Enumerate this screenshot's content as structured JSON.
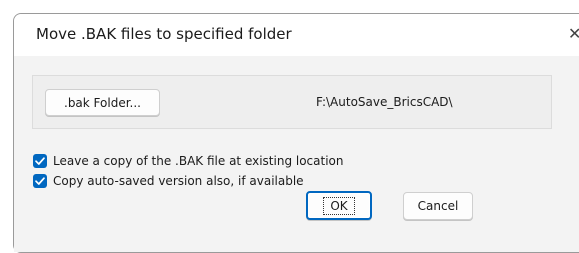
{
  "dialog": {
    "title": "Move .BAK files to specified folder",
    "close_symbol": "✕"
  },
  "folder_group": {
    "button_label": ".bak Folder...",
    "path": "F:\\AutoSave_BricsCAD\\"
  },
  "options": [
    {
      "label": "Leave a copy of the .BAK file at existing location",
      "checked": true
    },
    {
      "label": "Copy auto-saved version also, if available",
      "checked": true
    }
  ],
  "buttons": {
    "ok": "OK",
    "cancel": "Cancel"
  },
  "colors": {
    "accent": "#0067c0"
  }
}
